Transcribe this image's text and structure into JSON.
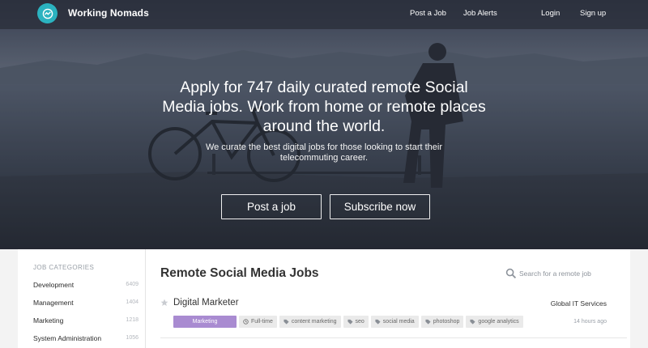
{
  "brand": {
    "name": "Working Nomads",
    "accent": "#2bb3c0"
  },
  "nav": {
    "post_job": "Post a Job",
    "job_alerts": "Job Alerts",
    "login": "Login",
    "signup": "Sign up"
  },
  "hero": {
    "title": "Apply for 747 daily curated remote Social Media jobs. Work from home or remote places around the world.",
    "subtitle": "We curate the best digital jobs for those looking to start their telecommuting career.",
    "post_button": "Post a job",
    "subscribe_button": "Subscribe now"
  },
  "sidebar": {
    "heading": "JOB CATEGORIES",
    "categories": [
      {
        "name": "Development",
        "count": "6409"
      },
      {
        "name": "Management",
        "count": "1404"
      },
      {
        "name": "Marketing",
        "count": "1218"
      },
      {
        "name": "System Administration",
        "count": "1056"
      }
    ]
  },
  "main": {
    "title": "Remote Social Media Jobs",
    "search_placeholder": "Search for a remote job",
    "jobs": [
      {
        "title": "Digital Marketer",
        "company": "Global IT Services",
        "category": "Marketing",
        "category_color": "#a98bd1",
        "type": "Full-time",
        "tags": [
          "content marketing",
          "seo",
          "social media",
          "photoshop",
          "google analytics"
        ],
        "posted": "14 hours ago"
      }
    ]
  }
}
